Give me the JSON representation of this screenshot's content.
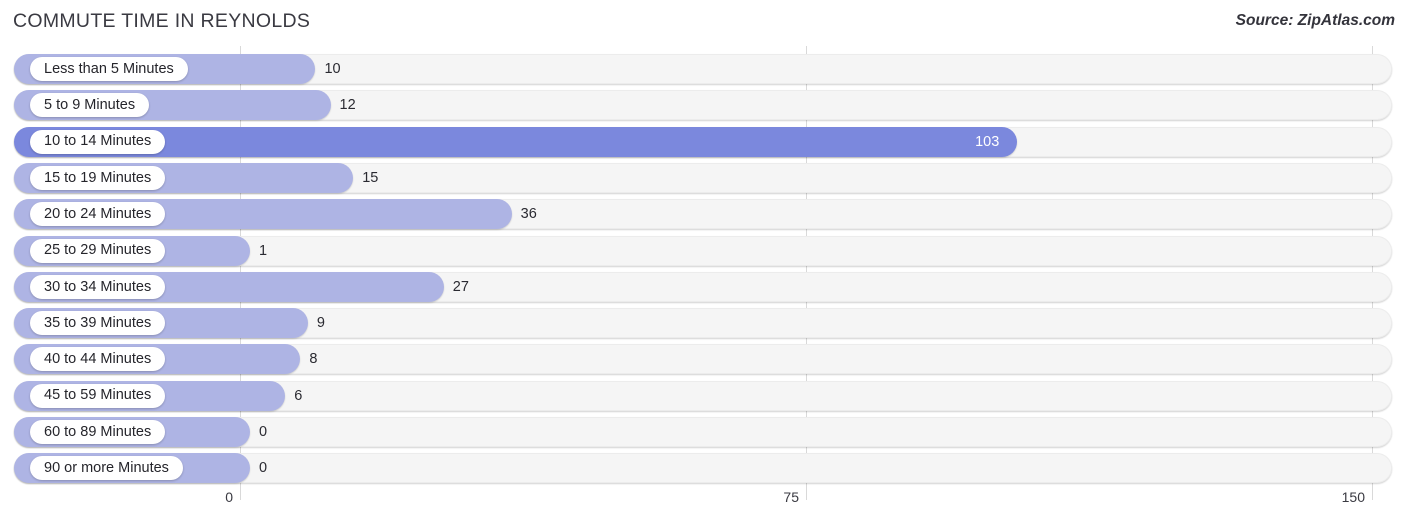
{
  "header": {
    "title": "COMMUTE TIME IN REYNOLDS",
    "source": "Source: ZipAtlas.com"
  },
  "colors": {
    "bar": "#aeb4e4",
    "bar_max": "#7b88dd",
    "track": "#f5f5f5",
    "gridline": "#d9d9d9",
    "text": "#2a2a31",
    "value_in_bar": "#ffffff"
  },
  "axis": {
    "ticks": [
      "0",
      "75",
      "150"
    ],
    "min": 0,
    "max": 150
  },
  "chart_data": {
    "type": "bar",
    "orientation": "horizontal",
    "title": "COMMUTE TIME IN REYNOLDS",
    "subtitle": "Source: ZipAtlas.com",
    "xlabel": "",
    "ylabel": "",
    "xlim": [
      0,
      150
    ],
    "xticks": [
      0,
      75,
      150
    ],
    "grid": true,
    "legend": false,
    "categories": [
      "Less than 5 Minutes",
      "5 to 9 Minutes",
      "10 to 14 Minutes",
      "15 to 19 Minutes",
      "20 to 24 Minutes",
      "25 to 29 Minutes",
      "30 to 34 Minutes",
      "35 to 39 Minutes",
      "40 to 44 Minutes",
      "45 to 59 Minutes",
      "60 to 89 Minutes",
      "90 or more Minutes"
    ],
    "values": [
      10,
      12,
      103,
      15,
      36,
      1,
      27,
      9,
      8,
      6,
      0,
      0
    ],
    "value_labels": [
      "10",
      "12",
      "103",
      "15",
      "36",
      "1",
      "27",
      "9",
      "8",
      "6",
      "0",
      "0"
    ],
    "highlight_index": 2
  }
}
